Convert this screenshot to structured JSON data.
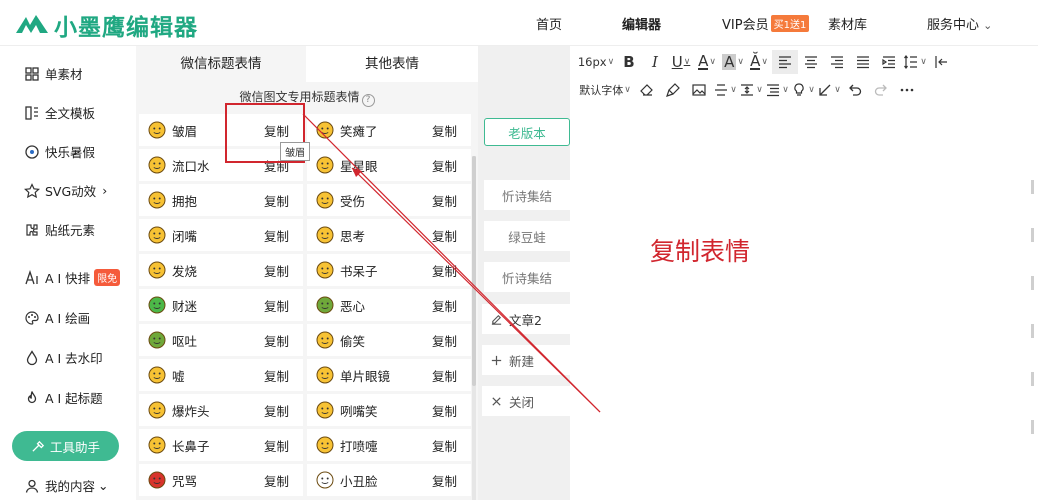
{
  "brand": {
    "name": "小墨鹰编辑器",
    "color": "#20a882"
  },
  "nav": {
    "home": "首页",
    "editor": "编辑器",
    "vip": "VIP会员",
    "vip_badge": "买1送1",
    "materials": "素材库",
    "service": "服务中心",
    "service_caret": "⌄"
  },
  "sidebar": {
    "items": [
      {
        "label": "单素材",
        "icon": "grid-icon"
      },
      {
        "label": "全文模板",
        "icon": "template-icon"
      },
      {
        "label": "快乐暑假",
        "icon": "ball-icon"
      },
      {
        "label": "SVG动效",
        "icon": "star-icon",
        "suffix": "›"
      },
      {
        "label": "贴纸元素",
        "icon": "puzzle-icon"
      },
      {
        "label": "A I 快排",
        "icon": "ai-icon",
        "badge": "限免"
      },
      {
        "label": "A I 绘画",
        "icon": "palette-icon"
      },
      {
        "label": "A I 去水印",
        "icon": "drop-icon"
      },
      {
        "label": "A I 起标题",
        "icon": "flame-icon"
      },
      {
        "label": "我的内容",
        "icon": "user-icon",
        "suffix": "⌄"
      }
    ],
    "tool_button": "工具助手"
  },
  "panel": {
    "tab_active": "微信标题表情",
    "tab_other": "其他表情",
    "subtitle": "微信图文专用标题表情",
    "help": "?",
    "copy_label": "复制",
    "tooltip": "皱眉",
    "rows": [
      [
        {
          "name": "皱眉",
          "color": "#f7c234"
        },
        {
          "name": "笑瘫了",
          "color": "#f7c234"
        }
      ],
      [
        {
          "name": "流口水",
          "color": "#f7c234"
        },
        {
          "name": "星星眼",
          "color": "#f7c234"
        }
      ],
      [
        {
          "name": "拥抱",
          "color": "#f7c234"
        },
        {
          "name": "受伤",
          "color": "#f7c234"
        }
      ],
      [
        {
          "name": "闭嘴",
          "color": "#f7c234"
        },
        {
          "name": "思考",
          "color": "#f7c234"
        }
      ],
      [
        {
          "name": "发烧",
          "color": "#f7c234"
        },
        {
          "name": "书呆子",
          "color": "#f7c234"
        }
      ],
      [
        {
          "name": "财迷",
          "color": "#4cb848"
        },
        {
          "name": "恶心",
          "color": "#6fa83a"
        }
      ],
      [
        {
          "name": "呕吐",
          "color": "#6fa83a"
        },
        {
          "name": "偷笑",
          "color": "#f7c234"
        }
      ],
      [
        {
          "name": "嘘",
          "color": "#f7c234"
        },
        {
          "name": "单片眼镜",
          "color": "#f7c234"
        }
      ],
      [
        {
          "name": "爆炸头",
          "color": "#f7c234"
        },
        {
          "name": "咧嘴笑",
          "color": "#f7c234"
        }
      ],
      [
        {
          "name": "长鼻子",
          "color": "#f7c234"
        },
        {
          "name": "打喷嚏",
          "color": "#f7c234"
        }
      ],
      [
        {
          "name": "咒骂",
          "color": "#d8342c"
        },
        {
          "name": "小丑脸",
          "color": "#ffffff"
        }
      ]
    ]
  },
  "middle": {
    "old_version": "老版本",
    "drafts": [
      "忻诗集结",
      "绿豆蛙",
      "忻诗集结"
    ],
    "doc": "文章2",
    "new": "新建",
    "close": "关闭"
  },
  "editor": {
    "font_size": "16px",
    "font_family": "默认字体",
    "annotation": "复制表情",
    "annotation_color": "#d1262e"
  }
}
